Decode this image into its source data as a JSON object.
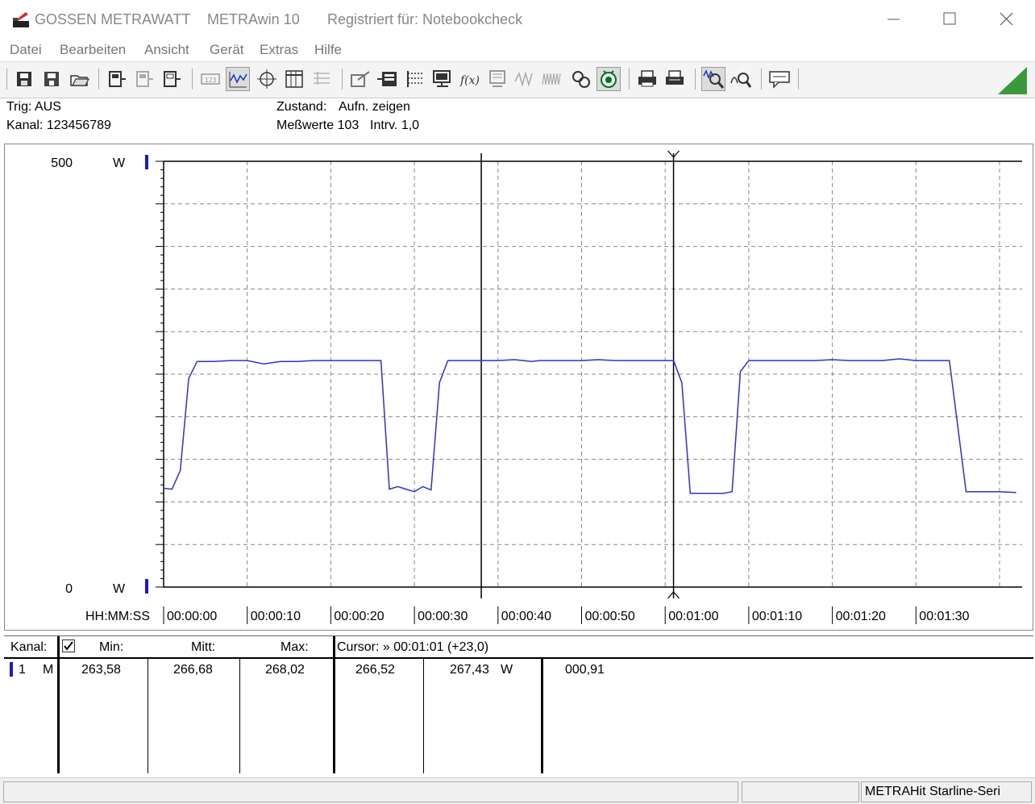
{
  "window": {
    "brand": "GOSSEN METRAWATT",
    "app": "METRAwin 10",
    "registered": "Registriert für: Notebookcheck"
  },
  "menu": [
    "Datei",
    "Bearbeiten",
    "Ansicht",
    "Gerät",
    "Extras",
    "Hilfe"
  ],
  "toolbar_icons": [
    "save-icon",
    "save-as-icon",
    "open-folder-icon",
    "device-icon",
    "device-disabled-icon",
    "device-connect-icon",
    "display-digits-icon",
    "line-chart-icon",
    "crosshair-icon",
    "table-icon",
    "table-grid-icon",
    "export-icon",
    "import-icon",
    "settings-icon",
    "monitor-icon",
    "formula-icon",
    "memory-icon",
    "wave-icon",
    "noise-icon",
    "print-setup-icon",
    "record-icon",
    "print-preview-icon",
    "print-icon",
    "zoom-icon",
    "zoom-out-icon",
    "comment-icon"
  ],
  "status_info": {
    "trig": "Trig: AUS",
    "kanal": "Kanal: 123456789",
    "zustand_label": "Zustand:",
    "zustand_value": "Aufn. zeigen",
    "messwerte": "Meßwerte 103",
    "intervall": "Intrv. 1,0"
  },
  "chart_data": {
    "type": "line",
    "ylim": [
      0,
      500
    ],
    "y_top_label": "500",
    "y_bottom_label": "0",
    "y_unit": "W",
    "x_axis_label": "HH:MM:SS",
    "x_tick_labels": [
      "00:00:00",
      "00:00:10",
      "00:00:20",
      "00:00:30",
      "00:00:40",
      "00:00:50",
      "00:01:00",
      "00:01:10",
      "00:01:20",
      "00:01:30"
    ],
    "xlim_seconds": [
      0,
      102
    ],
    "cursors_seconds": [
      38,
      61
    ],
    "series": [
      {
        "color": "#3030d0",
        "x": [
          0,
          1,
          2,
          3,
          4,
          5,
          6,
          8,
          10,
          12,
          14,
          16,
          18,
          20,
          22,
          24,
          25,
          26,
          27,
          28,
          29,
          30,
          31,
          32,
          33,
          34,
          35,
          36,
          37,
          38,
          40,
          42,
          44,
          45,
          46,
          48,
          50,
          52,
          54,
          56,
          58,
          60,
          61,
          62,
          63,
          64,
          65,
          66,
          67,
          68,
          69,
          70,
          71,
          72,
          74,
          76,
          78,
          80,
          82,
          84,
          86,
          88,
          90,
          91,
          92,
          93,
          94,
          96,
          98,
          100,
          102
        ],
        "y": [
          116,
          115,
          137,
          245,
          265,
          265,
          265,
          266,
          266,
          262,
          265,
          265,
          266,
          266,
          266,
          266,
          266,
          266,
          115,
          118,
          115,
          112,
          118,
          114,
          240,
          266,
          266,
          266,
          266,
          266,
          266,
          267,
          265,
          266,
          266,
          266,
          266,
          267,
          266,
          266,
          266,
          266,
          266,
          240,
          110,
          110,
          110,
          110,
          110,
          112,
          253,
          266,
          266,
          266,
          266,
          266,
          266,
          267,
          266,
          266,
          266,
          268,
          266,
          266,
          266,
          266,
          266,
          112,
          112,
          112,
          111
        ]
      }
    ]
  },
  "table": {
    "header": {
      "kanal": "Kanal:",
      "min": "Min:",
      "mitt": "Mitt:",
      "max": "Max:",
      "cursor": "Cursor: » 00:01:01 (+23,0)"
    },
    "row": {
      "channel": "1",
      "mode": "M",
      "min": "263,58",
      "mitt": "266,68",
      "max": "268,02",
      "cursor_a": "266,52",
      "cursor_b": "267,43",
      "unit": "W",
      "delta": "000,91"
    }
  },
  "statusbar": {
    "device": "METRAHit Starline-Seri"
  }
}
